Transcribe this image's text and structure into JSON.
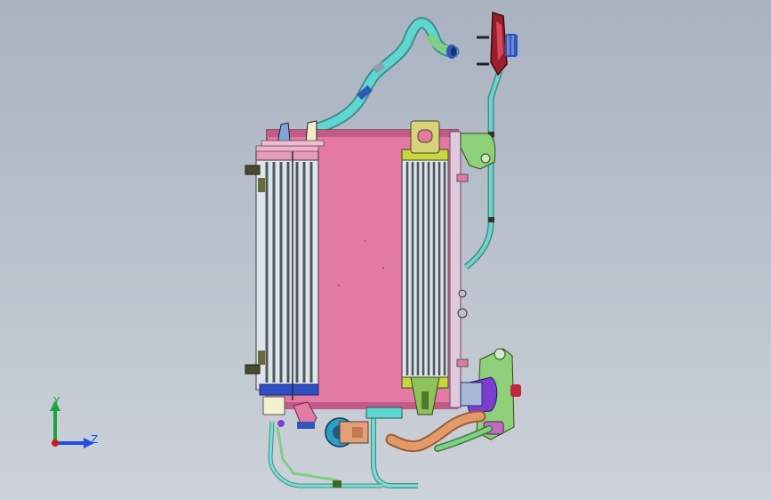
{
  "viewport": {
    "background_top": "#a9b2c1",
    "background_bottom": "#cdd2da"
  },
  "model": {
    "parts": [
      "radiator-core",
      "condenser-left",
      "oil-cooler-right",
      "coolant-hoses",
      "fan-motor",
      "water-pump",
      "heater-valve",
      "mounting-brackets",
      "bolts"
    ],
    "colors": {
      "radiator": "#e27aa4",
      "condenser": "#7a7f86",
      "hose_cyan": "#5fd6cf",
      "hose_green": "#7fcf84",
      "hose_orange": "#e29a6a",
      "purple": "#7a3fd1",
      "blue": "#2f56b8",
      "yellow": "#e2e07a",
      "red": "#c2283a"
    }
  },
  "triad": {
    "y_label": "Y",
    "z_label": "Z",
    "y_color": "#1aa63a",
    "z_color": "#1f4fe0",
    "x_color": "#d11a1a"
  }
}
